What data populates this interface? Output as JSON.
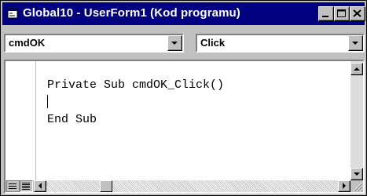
{
  "window": {
    "title": "Global10 - UserForm1 (Kod programu)"
  },
  "object_combo": {
    "value": "cmdOK"
  },
  "procedure_combo": {
    "value": "Click"
  },
  "code": {
    "lines": [
      "Private Sub cmdOK_Click()",
      "",
      "End Sub"
    ]
  },
  "icons": {
    "window_icon": "vba-module-icon",
    "minimize": "minimize-icon",
    "maximize": "maximize-icon",
    "close": "close-icon"
  },
  "colors": {
    "titlebar": "#000080",
    "face": "#c0c0c0",
    "editor_bg": "#ffffff"
  }
}
